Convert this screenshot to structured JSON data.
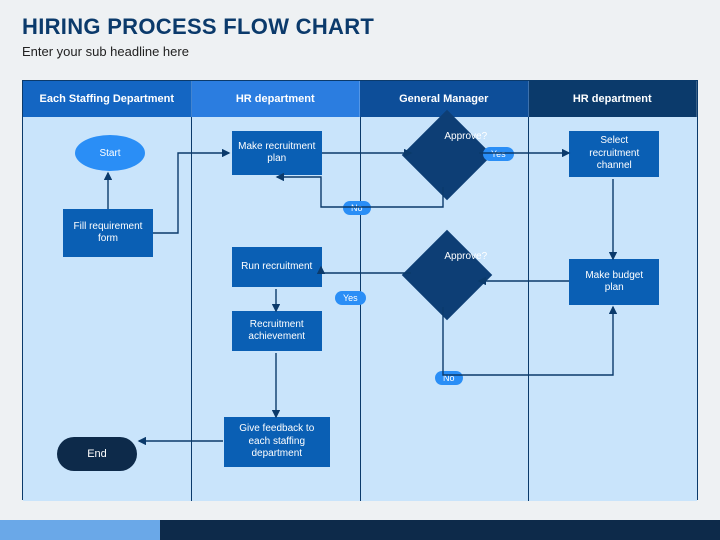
{
  "title": "HIRING PROCESS FLOW CHART",
  "subtitle": "Enter your sub headline here",
  "lanes": [
    "Each Staffing Department",
    "HR department",
    "General Manager",
    "HR department"
  ],
  "nodes": {
    "start": "Start",
    "fill": "Fill requirement form",
    "plan": "Make recruitment plan",
    "run": "Run recruitment",
    "achieve": "Recruitment achievement",
    "feedback": "Give feedback to each staffing department",
    "approve1": "Approve?",
    "approve2": "Approve?",
    "select": "Select recruitment channel",
    "budget": "Make budget plan",
    "end": "End"
  },
  "labels": {
    "yes": "Yes",
    "no": "No"
  }
}
